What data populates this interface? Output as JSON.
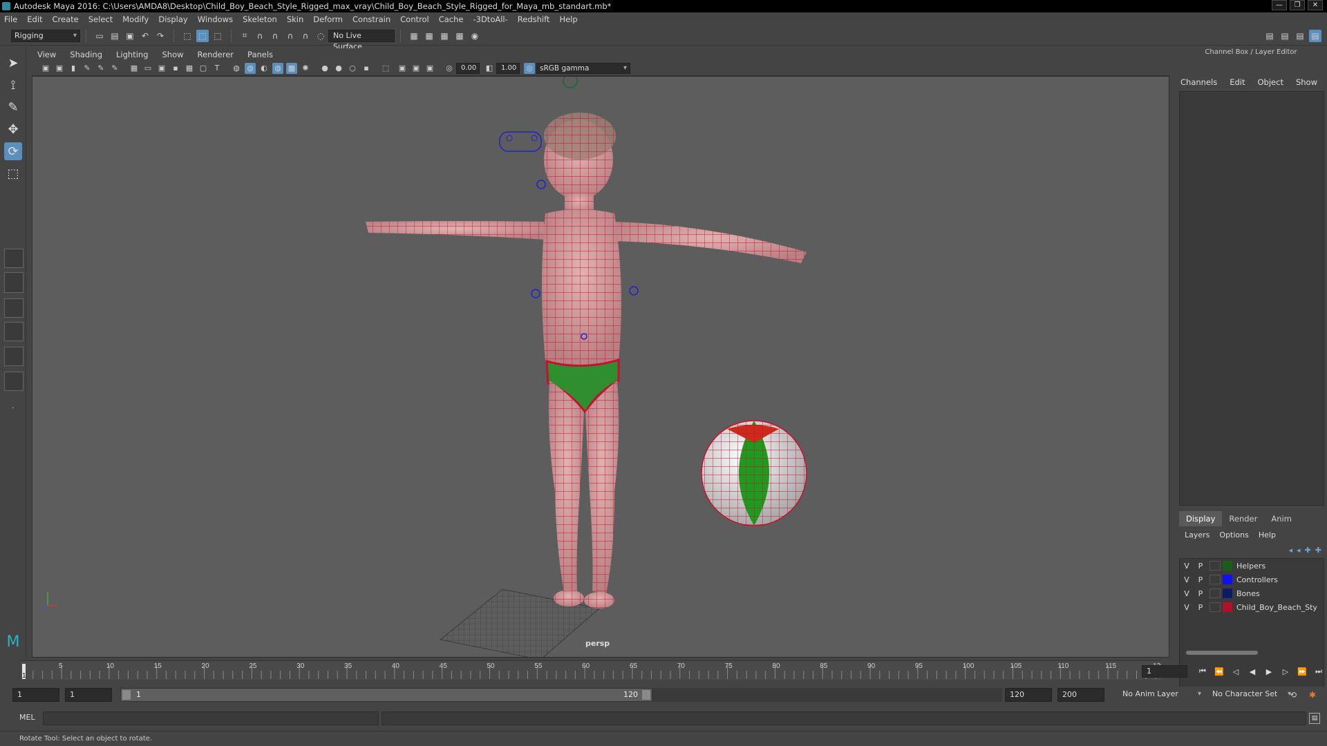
{
  "window": {
    "title": "Autodesk Maya 2016: C:\\Users\\AMDA8\\Desktop\\Child_Boy_Beach_Style_Rigged_max_vray\\Child_Boy_Beach_Style_Rigged_for_Maya_mb_standart.mb*",
    "buttons": [
      "—",
      "❐",
      "✕"
    ]
  },
  "menubar": [
    "File",
    "Edit",
    "Create",
    "Select",
    "Modify",
    "Display",
    "Windows",
    "Skeleton",
    "Skin",
    "Deform",
    "Constrain",
    "Control",
    "Cache",
    "-3DtoAll-",
    "Redshift",
    "Help"
  ],
  "statusline": {
    "menuset": "Rigging",
    "live_surface": "No Live Surface"
  },
  "panel": {
    "menus": [
      "View",
      "Shading",
      "Lighting",
      "Show",
      "Renderer",
      "Panels"
    ],
    "exposure": "0.00",
    "gamma": "1.00",
    "color_space": "sRGB gamma",
    "camera_label": "persp"
  },
  "channel_box": {
    "header": "Channel Box / Layer Editor",
    "menus": [
      "Channels",
      "Edit",
      "Object",
      "Show"
    ]
  },
  "layer_editor": {
    "tabs": [
      "Display",
      "Render",
      "Anim"
    ],
    "menus": [
      "Layers",
      "Options",
      "Help"
    ],
    "layers": [
      {
        "v": "V",
        "p": "P",
        "name": "Helpers",
        "color": "#1a5c1a"
      },
      {
        "v": "V",
        "p": "P",
        "name": "Controllers",
        "color": "#1010f0"
      },
      {
        "v": "V",
        "p": "P",
        "name": "Bones",
        "color": "#0d1a66"
      },
      {
        "v": "V",
        "p": "P",
        "name": "Child_Boy_Beach_Style",
        "color": "#b0102a"
      }
    ]
  },
  "timeslider": {
    "ticks": [
      "1",
      "5",
      "10",
      "15",
      "20",
      "25",
      "30",
      "35",
      "40",
      "45",
      "50",
      "55",
      "60",
      "65",
      "70",
      "75",
      "80",
      "85",
      "90",
      "95",
      "100",
      "105",
      "110",
      "115",
      "120"
    ],
    "current_frame": "1"
  },
  "rangeslider": {
    "start": "1",
    "playback_start": "1",
    "range_start": "1",
    "range_end": "120",
    "playback_end": "120",
    "end": "200",
    "anim_layer": "No Anim Layer",
    "character_set": "No Character Set"
  },
  "cmdline": {
    "label": "MEL"
  },
  "helpline": {
    "text": "Rotate Tool: Select an object to rotate."
  },
  "colors": {
    "wire": "#c8102e",
    "skin": "#d9a8a8",
    "viewport_bg": "#5d5d5d",
    "accent": "#5b8fbd"
  }
}
